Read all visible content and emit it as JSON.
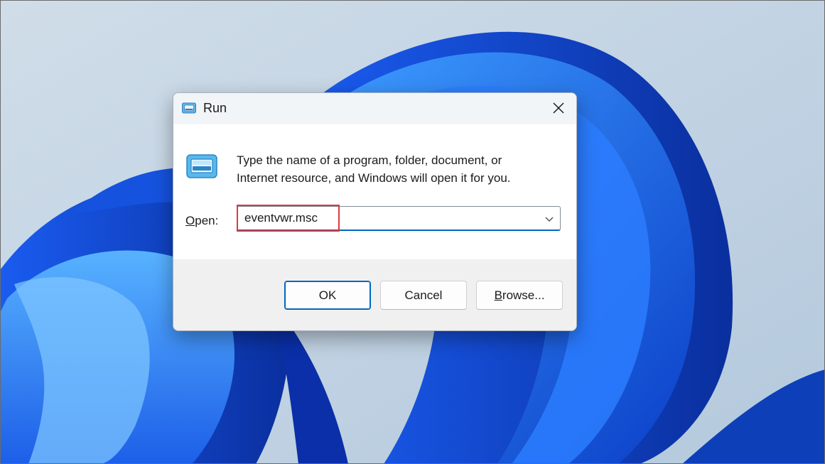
{
  "dialog": {
    "title": "Run",
    "description_line1": "Type the name of a program, folder, document, or",
    "description_line2": "Internet resource, and Windows will open it for you.",
    "open_label_mnemonic": "O",
    "open_label_rest": "pen:",
    "input_value": "eventvwr.msc",
    "buttons": {
      "ok": "OK",
      "cancel": "Cancel",
      "browse_mnemonic": "B",
      "browse_rest": "rowse..."
    }
  },
  "icons": {
    "title": "run-icon",
    "content": "run-icon",
    "close": "close-icon",
    "dropdown": "chevron-down-icon"
  },
  "colors": {
    "accent": "#0067c0",
    "highlight": "#e0373d",
    "wallpaper_blue": "#1f6fff"
  }
}
